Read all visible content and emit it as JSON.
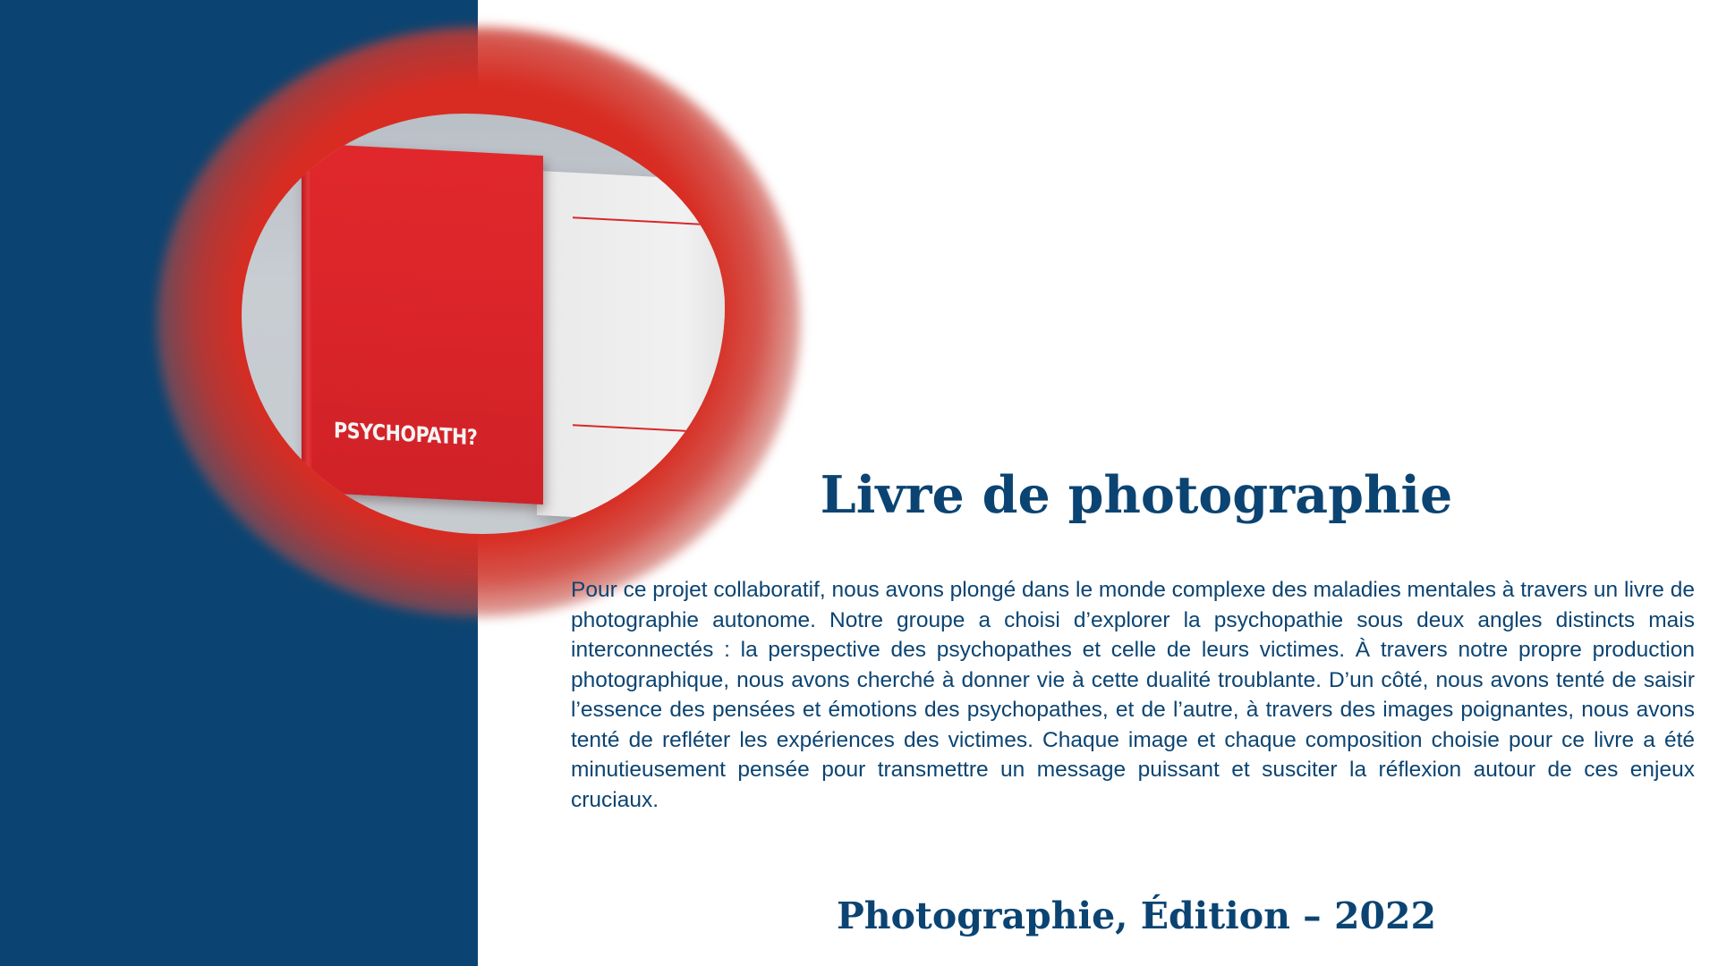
{
  "colors": {
    "navy": "#0b4472",
    "red": "#d8282c",
    "white": "#ffffff"
  },
  "image": {
    "subject": "book-mockup",
    "cover_title": "PSYCHOPATH?"
  },
  "heading": "Livre de photographie",
  "body": "Pour ce projet collaboratif,  nous avons plongé dans le monde complexe des maladies mentales à travers un livre de photographie autonome. Notre groupe a choisi d’explorer la psychopathie sous deux angles distincts mais interconnectés : la perspective des psychopathes et celle de leurs victimes. À travers notre propre production photographique, nous avons cherché à donner vie à cette dualité troublante. D’un côté, nous avons tenté de saisir l’essence des pensées et émotions des psychopathes, et de l’autre, à travers des images poignantes, nous avons tenté de refléter les expériences des victimes. Chaque image et chaque composition choisie pour ce livre a été minutieusement pensée pour transmettre un message puissant et susciter la réflexion autour de ces enjeux cruciaux.",
  "footer": "Photographie, Édition – 2022"
}
